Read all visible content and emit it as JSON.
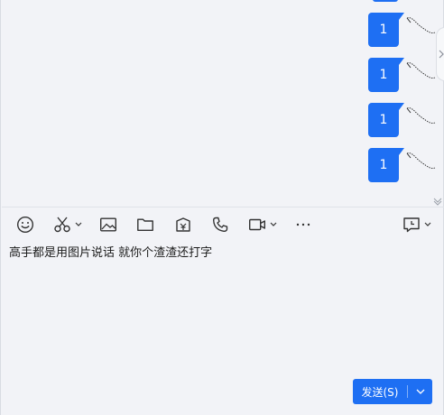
{
  "chat": {
    "messages": [
      {
        "text": "1"
      },
      {
        "text": "1"
      },
      {
        "text": "1"
      },
      {
        "text": "1"
      }
    ]
  },
  "toolbar": {
    "items": [
      {
        "icon": "emoji-icon"
      },
      {
        "icon": "scissors-icon",
        "has_dropdown": true
      },
      {
        "icon": "image-icon"
      },
      {
        "icon": "folder-icon"
      },
      {
        "icon": "red-packet-icon"
      },
      {
        "icon": "phone-icon"
      },
      {
        "icon": "video-icon",
        "has_dropdown": true
      },
      {
        "icon": "more-icon"
      },
      {
        "icon": "history-icon",
        "has_dropdown": true
      }
    ]
  },
  "input": {
    "value": "高手都是用图片说话 就你个渣渣还打字"
  },
  "send": {
    "label": "发送(S)"
  },
  "colors": {
    "accent": "#1e6ff3",
    "background": "#f2f3f7",
    "icon": "#333333"
  }
}
